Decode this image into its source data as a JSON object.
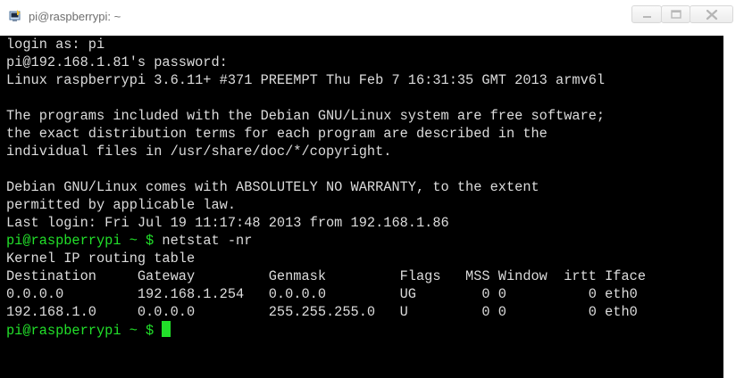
{
  "window": {
    "title": "pi@raspberrypi: ~"
  },
  "terminal": {
    "lines": [
      "login as: pi",
      "pi@192.168.1.81's password:",
      "Linux raspberrypi 3.6.11+ #371 PREEMPT Thu Feb 7 16:31:35 GMT 2013 armv6l",
      "",
      "The programs included with the Debian GNU/Linux system are free software;",
      "the exact distribution terms for each program are described in the",
      "individual files in /usr/share/doc/*/copyright.",
      "",
      "Debian GNU/Linux comes with ABSOLUTELY NO WARRANTY, to the extent",
      "permitted by applicable law.",
      "Last login: Fri Jul 19 11:17:48 2013 from 192.168.1.86"
    ],
    "prompt": "pi@raspberrypi ~ $",
    "command": "netstat -nr",
    "output_title": "Kernel IP routing table",
    "routing_header": "Destination     Gateway         Genmask         Flags   MSS Window  irtt Iface",
    "routing_rows": [
      "0.0.0.0         192.168.1.254   0.0.0.0         UG        0 0          0 eth0",
      "192.168.1.0     0.0.0.0         255.255.255.0   U         0 0          0 eth0"
    ],
    "colors": {
      "background": "#000000",
      "text": "#dcdcdc",
      "prompt": "#22e02a",
      "cursor": "#22e02a"
    }
  }
}
